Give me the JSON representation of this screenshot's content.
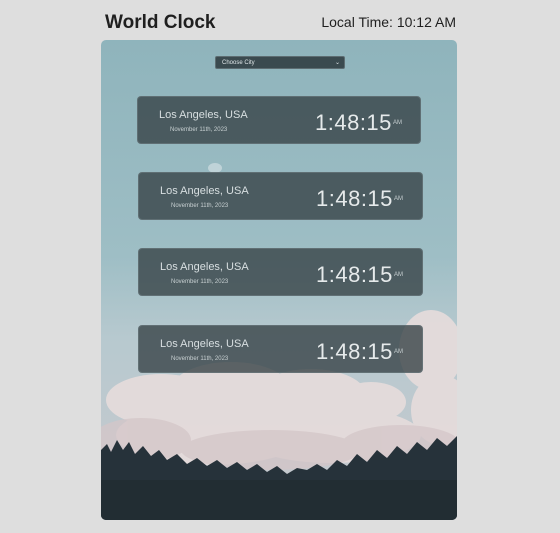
{
  "header": {
    "title": "World Clock",
    "local_time": "Local Time: 10:12 AM"
  },
  "city_select": {
    "value": "Choose City",
    "icon": "chevron-down-icon"
  },
  "clocks": [
    {
      "city": "Los Angeles, USA",
      "date": "November 11th, 2023",
      "time": "1:48:15",
      "ampm": "AM"
    },
    {
      "city": "Los Angeles, USA",
      "date": "November 11th, 2023",
      "time": "1:48:15",
      "ampm": "AM"
    },
    {
      "city": "Los Angeles, USA",
      "date": "November 11th, 2023",
      "time": "1:48:15",
      "ampm": "AM"
    },
    {
      "city": "Los Angeles, USA",
      "date": "November 11th, 2023",
      "time": "1:48:15",
      "ampm": "AM"
    }
  ],
  "colors": {
    "sky": "#8fb4bc",
    "card": "#344044",
    "trees": "#26323a"
  }
}
